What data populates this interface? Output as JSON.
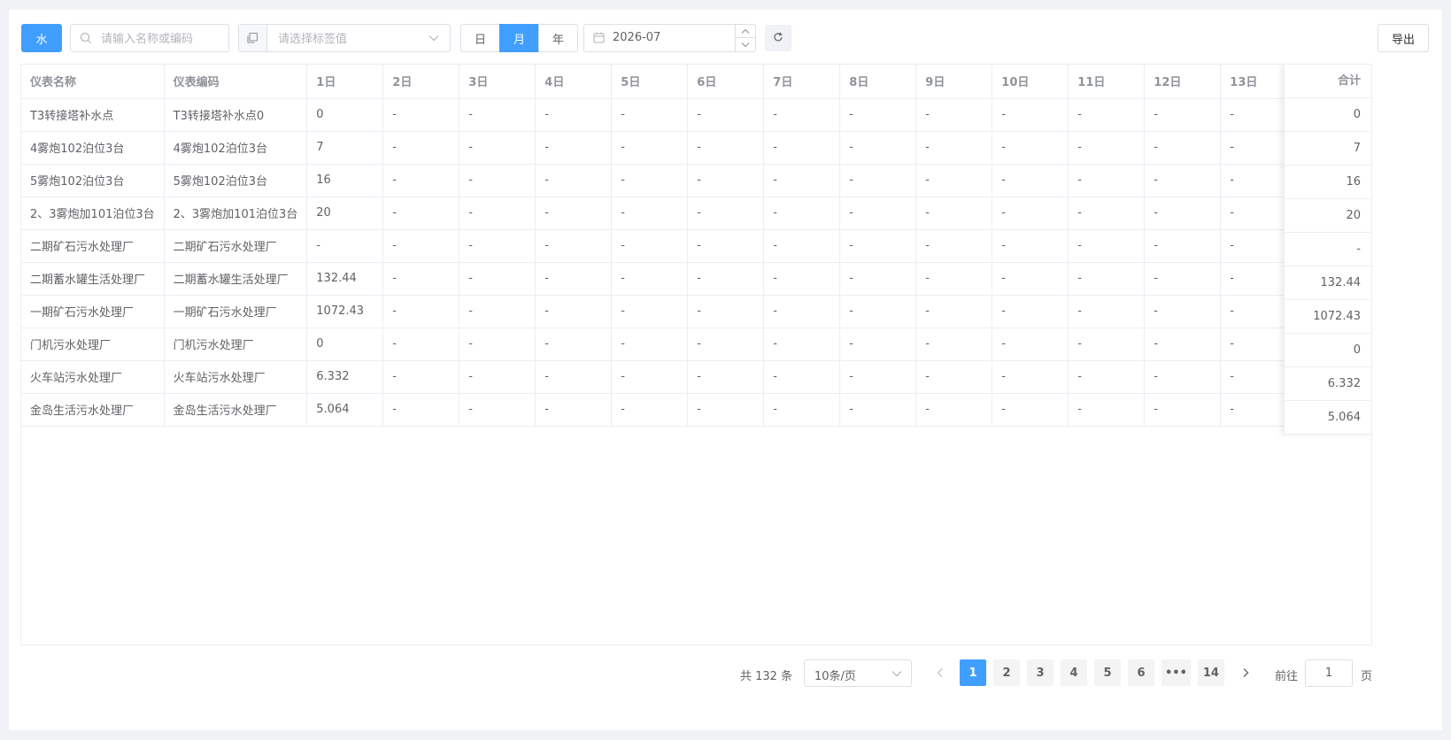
{
  "toolbar": {
    "water_label": "水",
    "search_placeholder": "请输入名称或编码",
    "tag_placeholder": "请选择标签值",
    "period": [
      "日",
      "月",
      "年"
    ],
    "active_period": "月",
    "date_value": "2026-07",
    "export_label": "导出"
  },
  "table": {
    "headers": [
      "仪表名称",
      "仪表编码",
      "1日",
      "2日",
      "3日",
      "4日",
      "5日",
      "6日",
      "7日",
      "8日",
      "9日",
      "10日",
      "11日",
      "12日",
      "13日"
    ],
    "total_header": "合计",
    "rows": [
      {
        "name": "T3转接塔补水点",
        "code": "T3转接塔补水点0",
        "d1": "0",
        "total": "0"
      },
      {
        "name": "4雾炮102泊位3台",
        "code": "4雾炮102泊位3台",
        "d1": "7",
        "total": "7"
      },
      {
        "name": "5雾炮102泊位3台",
        "code": "5雾炮102泊位3台",
        "d1": "16",
        "total": "16"
      },
      {
        "name": "2、3雾炮加101泊位3台",
        "code": "2、3雾炮加101泊位3台",
        "d1": "20",
        "total": "20"
      },
      {
        "name": "二期矿石污水处理厂",
        "code": "二期矿石污水处理厂",
        "d1": "-",
        "total": "-"
      },
      {
        "name": "二期蓄水罐生活处理厂",
        "code": "二期蓄水罐生活处理厂",
        "d1": "132.44",
        "total": "132.44"
      },
      {
        "name": "一期矿石污水处理厂",
        "code": "一期矿石污水处理厂",
        "d1": "1072.43",
        "total": "1072.43"
      },
      {
        "name": "门机污水处理厂",
        "code": "门机污水处理厂",
        "d1": "0",
        "total": "0"
      },
      {
        "name": "火车站污水处理厂",
        "code": "火车站污水处理厂",
        "d1": "6.332",
        "total": "6.332"
      },
      {
        "name": "金岛生活污水处理厂",
        "code": "金岛生活污水处理厂",
        "d1": "5.064",
        "total": "5.064"
      }
    ],
    "empty_cell": "-"
  },
  "pagination": {
    "total_text": "共 132 条",
    "page_size": "10条/页",
    "pages": [
      "1",
      "2",
      "3",
      "4",
      "5",
      "6",
      "•••",
      "14"
    ],
    "current_page": "1",
    "goto_label": "前往",
    "goto_value": "1",
    "goto_suffix": "页"
  },
  "colors": {
    "primary": "#409eff",
    "border": "#dcdfe6",
    "background": "#f0f2f5"
  }
}
